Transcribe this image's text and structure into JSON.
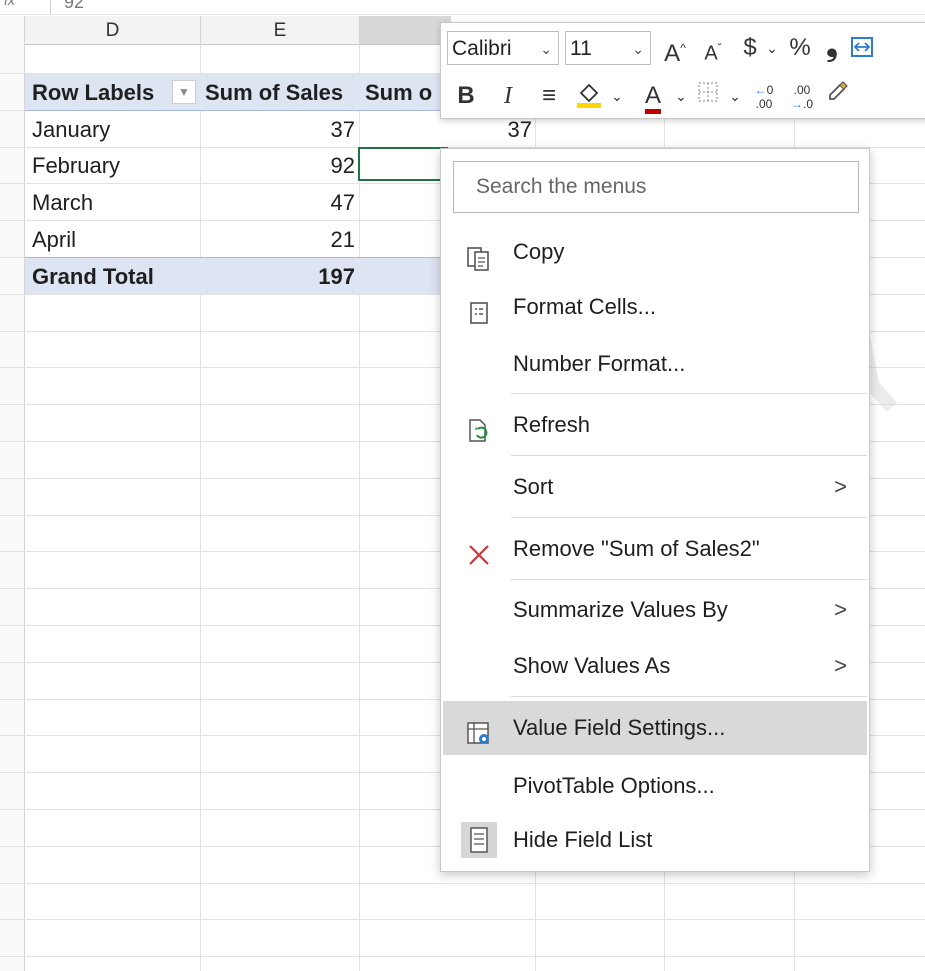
{
  "formula_bar": {
    "fx": "fx",
    "value": "92"
  },
  "columns": [
    {
      "letter": "D"
    },
    {
      "letter": "E"
    },
    {
      "letter": ""
    }
  ],
  "pivot": {
    "header_row_labels": "Row Labels",
    "header_sum_of_sales": "Sum of Sales",
    "header_sum_of_sales2": "Sum o",
    "rows": [
      {
        "label": "January",
        "sales": "37",
        "sales2": "37"
      },
      {
        "label": "February",
        "sales": "92",
        "sales2": ""
      },
      {
        "label": "March",
        "sales": "47",
        "sales2": ""
      },
      {
        "label": "April",
        "sales": "21",
        "sales2": ""
      }
    ],
    "total_label": "Grand Total",
    "total_value": "197"
  },
  "mini_toolbar": {
    "font_name": "Calibri",
    "font_size": "11",
    "bold": "B",
    "italic": "I",
    "currency": "$",
    "percent": "%",
    "comma": "❟",
    "increase_font": "A",
    "decrease_font": "A",
    "font_color_letter": "A",
    "font_color": "#c00000",
    "fill_color": "#ffd700",
    "dec_increase": ".00",
    "dec_decrease": ".0"
  },
  "context_menu": {
    "search_placeholder": "Search the menus",
    "items": [
      {
        "label": "Copy",
        "icon": "copy-icon"
      },
      {
        "label": "Format Cells...",
        "icon": "format-cells-icon"
      },
      {
        "label": "Number Format...",
        "icon": ""
      },
      {
        "label": "Refresh",
        "icon": "refresh-icon"
      },
      {
        "label": "Sort",
        "icon": "",
        "submenu": true
      },
      {
        "label": "Remove \"Sum of Sales2\"",
        "icon": "remove-x-icon"
      },
      {
        "label": "Summarize Values By",
        "icon": "",
        "submenu": true
      },
      {
        "label": "Show Values As",
        "icon": "",
        "submenu": true
      },
      {
        "label": "Value Field Settings...",
        "icon": "value-field-settings-icon",
        "highlighted": true
      },
      {
        "label": "PivotTable Options...",
        "icon": ""
      },
      {
        "label": "Hide Field List",
        "icon": "field-list-icon"
      }
    ],
    "submenu_arrow": ">",
    "highlight_color": "#d9d9d9",
    "remove_icon_color": "#d13438"
  },
  "watermark": "CHOLOGY",
  "colors": {
    "pivot_header_band": "#dde4f2",
    "active_cell_border": "#217346"
  }
}
